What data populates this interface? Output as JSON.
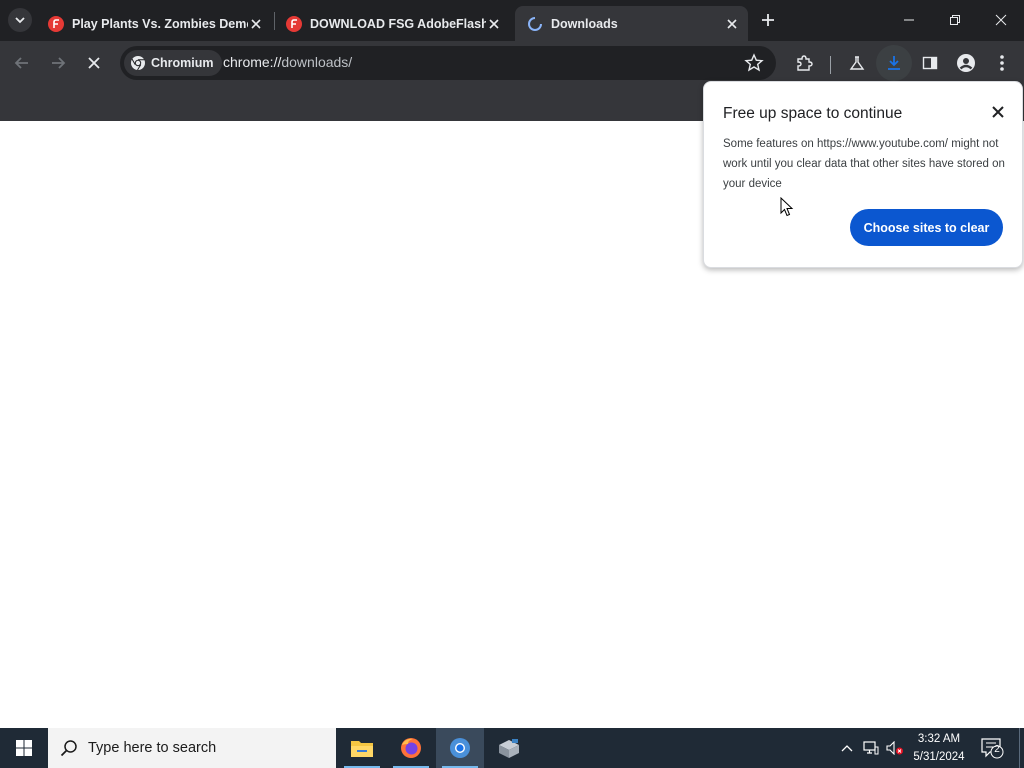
{
  "browser": {
    "brand_chip": "Chromium",
    "url_host": "chrome://",
    "url_path": "downloads/",
    "tabs": [
      {
        "title": "Play Plants Vs. Zombies Demo",
        "favicon": "flash-f-icon",
        "active": false
      },
      {
        "title": "DOWNLOAD FSG AdobeFlashP",
        "favicon": "flash-f-icon",
        "active": false
      },
      {
        "title": "Downloads",
        "favicon": "loading-spinner-icon",
        "active": true
      }
    ]
  },
  "bubble": {
    "title": "Free up space to continue",
    "body": "Some features on https://www.youtube.com/ might not work until you clear data that other sites have stored on your device",
    "button": "Choose sites to clear"
  },
  "taskbar": {
    "search_placeholder": "Type here to search",
    "time": "3:32 AM",
    "date": "5/31/2024",
    "notification_count": "2",
    "apps": [
      "file-explorer-icon",
      "firefox-icon",
      "chromium-icon",
      "app-installer-icon"
    ]
  },
  "colors": {
    "titlebar": "#202124",
    "toolbar": "#35363a",
    "accent_button": "#0b57d0",
    "taskbar": "#1f2a36"
  }
}
